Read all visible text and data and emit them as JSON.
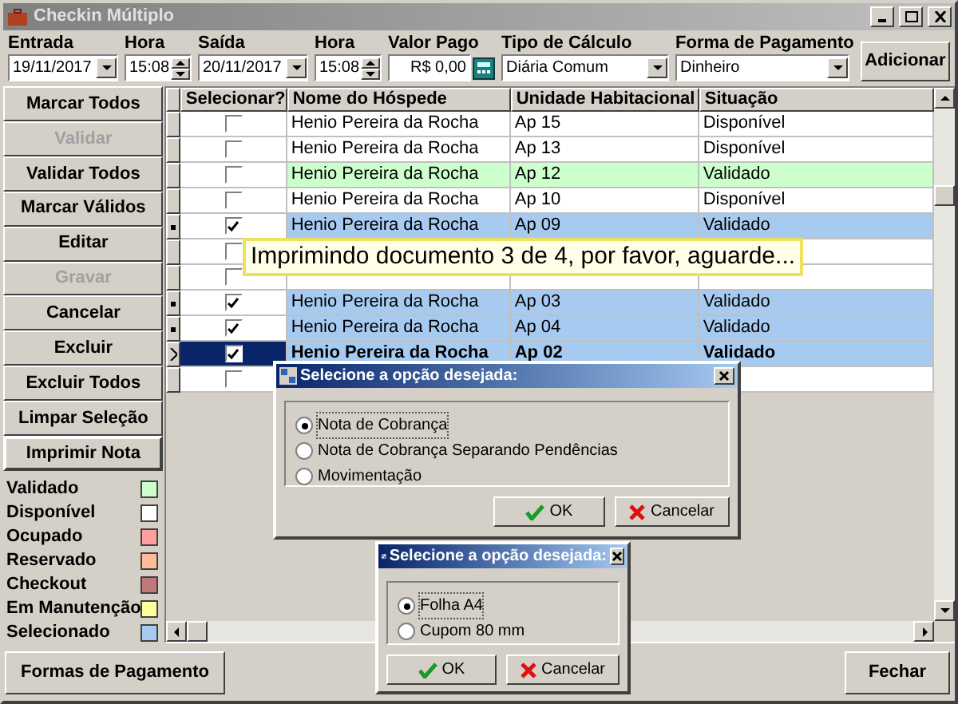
{
  "window": {
    "title": "Checkin Múltiplo"
  },
  "filters": [
    {
      "kind": "combo",
      "label": "Entrada",
      "value": "19/11/2017"
    },
    {
      "kind": "spin",
      "label": "Hora",
      "value": "15:08"
    },
    {
      "kind": "combo",
      "label": "Saída",
      "value": "20/11/2017"
    },
    {
      "kind": "spin",
      "label": "Hora",
      "value": "15:08"
    },
    {
      "kind": "money",
      "label": "Valor Pago",
      "value": "R$ 0,00"
    },
    {
      "kind": "combo",
      "label": "Tipo de Cálculo",
      "value": "Diária Comum"
    },
    {
      "kind": "combo",
      "label": "Forma de Pagamento",
      "value": "Dinheiro"
    }
  ],
  "add_button": "Adicionar",
  "side_buttons": [
    {
      "label": "Marcar Todos",
      "disabled": false
    },
    {
      "label": "Validar",
      "disabled": true
    },
    {
      "label": "Validar Todos",
      "disabled": false
    },
    {
      "label": "Marcar Válidos",
      "disabled": false
    },
    {
      "label": "Editar",
      "disabled": false
    },
    {
      "label": "Gravar",
      "disabled": true
    },
    {
      "label": "Cancelar",
      "disabled": false
    },
    {
      "label": "Excluir",
      "disabled": false
    },
    {
      "label": "Excluir Todos",
      "disabled": false
    },
    {
      "label": "Limpar Seleção",
      "disabled": false
    },
    {
      "label": "Imprimir Nota",
      "disabled": false
    }
  ],
  "legend": [
    {
      "label": "Validado",
      "color": "#ccffcc"
    },
    {
      "label": "Disponível",
      "color": "#ffffff"
    },
    {
      "label": "Ocupado",
      "color": "#ff9f9f"
    },
    {
      "label": "Reservado",
      "color": "#ffbb9a"
    },
    {
      "label": "Checkout",
      "color": "#c07878"
    },
    {
      "label": "Em Manutenção",
      "color": "#ffff99"
    },
    {
      "label": "Selecionado",
      "color": "#a6caf0"
    }
  ],
  "table": {
    "columns": [
      "Selecionar?",
      "Nome do Hóspede",
      "Unidade Habitacional",
      "Situação"
    ],
    "rows": [
      {
        "checked": false,
        "selected": false,
        "color": "#ffffff",
        "name": "Henio Pereira da Rocha",
        "unit": "Ap 15",
        "status": "Disponível"
      },
      {
        "checked": false,
        "selected": false,
        "color": "#ffffff",
        "name": "Henio Pereira da Rocha",
        "unit": "Ap 13",
        "status": "Disponível"
      },
      {
        "checked": false,
        "selected": false,
        "color": "#ccffcc",
        "name": "Henio Pereira da Rocha",
        "unit": "Ap 12",
        "status": "Validado"
      },
      {
        "checked": false,
        "selected": false,
        "color": "#ffffff",
        "name": "Henio Pereira da Rocha",
        "unit": "Ap 10",
        "status": "Disponível"
      },
      {
        "checked": true,
        "selected": false,
        "color": "#a6caf0",
        "name": "Henio Pereira da Rocha",
        "unit": "Ap 09",
        "status": "Validado"
      },
      {
        "checked": false,
        "selected": false
      },
      {
        "checked": false,
        "selected": false
      },
      {
        "checked": true,
        "selected": false,
        "color": "#a6caf0",
        "name": "Henio Pereira da Rocha",
        "unit": "Ap 03",
        "status": "Validado"
      },
      {
        "checked": true,
        "selected": false,
        "color": "#a6caf0",
        "name": "Henio Pereira da Rocha",
        "unit": "Ap 04",
        "status": "Validado"
      },
      {
        "checked": true,
        "selected": true,
        "color": "#a6caf0",
        "name": "Henio Pereira da Rocha",
        "unit": "Ap 02",
        "status": "Validado"
      },
      {
        "checked": false,
        "selected": false
      }
    ]
  },
  "progress_tip": "Imprimindo documento 3 de 4, por favor, aguarde...",
  "dialogs": [
    {
      "title": "Selecione a opção desejada:",
      "options": [
        {
          "label": "Nota de Cobrança",
          "selected": true
        },
        {
          "label": "Nota de Cobrança Separando Pendências",
          "selected": false
        },
        {
          "label": "Movimentação",
          "selected": false
        }
      ],
      "ok": "OK",
      "cancel": "Cancelar"
    },
    {
      "title": "Selecione a opção desejada:",
      "options": [
        {
          "label": "Folha A4",
          "selected": true
        },
        {
          "label": "Cupom 80 mm",
          "selected": false
        }
      ],
      "ok": "OK",
      "cancel": "Cancelar"
    }
  ],
  "bottom_buttons": [
    "Formas de Pagamento",
    "Fechar"
  ]
}
